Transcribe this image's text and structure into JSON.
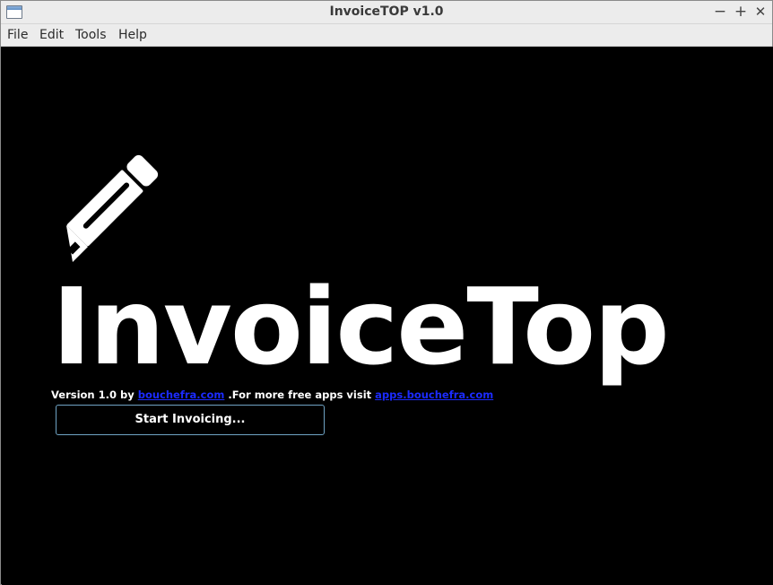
{
  "window": {
    "title": "InvoiceTOP v1.0",
    "controls": {
      "minimize": "−",
      "maximize": "+",
      "close": "✕"
    }
  },
  "menu": {
    "items": [
      "File",
      "Edit",
      "Tools",
      "Help"
    ]
  },
  "splash": {
    "logo_icon": "pencil-icon",
    "logo_text": "InvoiceTop",
    "version_prefix": "Version 1.0 by ",
    "author_link": "bouchefra.com",
    "more_text": " .For more free apps visit ",
    "apps_link": "apps.bouchefra.com",
    "start_button": "Start Invoicing..."
  },
  "colors": {
    "background": "#000000",
    "link": "#1b2bff",
    "button_border": "#6fa3c4"
  }
}
